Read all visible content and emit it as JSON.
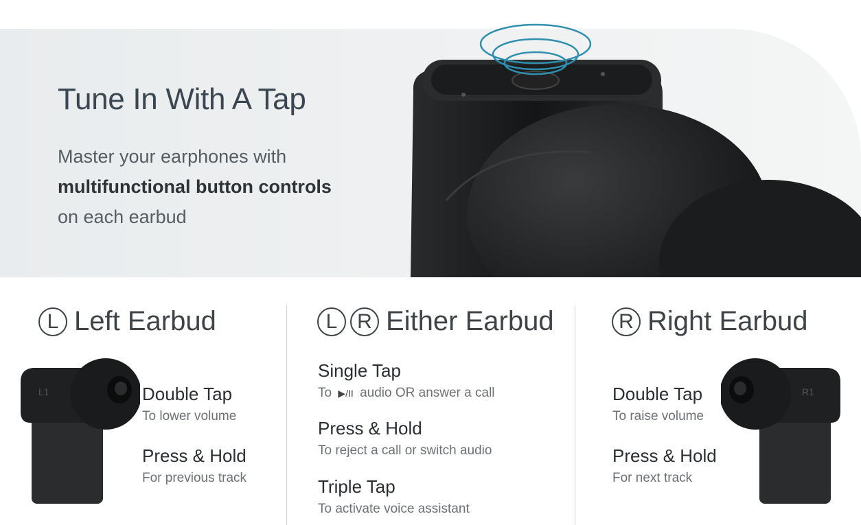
{
  "hero": {
    "title": "Tune In With A Tap",
    "subtitle_line1": "Master your earphones with",
    "subtitle_bold": "multifunctional button controls",
    "subtitle_line3": "on each earbud"
  },
  "columns": {
    "left": {
      "badge": "L",
      "title": "Left Earbud",
      "bud_label": "L1",
      "actions": [
        {
          "title": "Double Tap",
          "desc": "To lower volume"
        },
        {
          "title": "Press & Hold",
          "desc": "For previous track"
        }
      ]
    },
    "either": {
      "badge_left": "L",
      "badge_right": "R",
      "title": "Either Earbud",
      "actions": [
        {
          "title": "Single Tap",
          "desc_prefix": "To",
          "desc_symbol": "▶/II",
          "desc_suffix": "audio OR answer a call"
        },
        {
          "title": "Press & Hold",
          "desc": "To reject a call or switch audio"
        },
        {
          "title": "Triple Tap",
          "desc": "To activate voice assistant"
        }
      ]
    },
    "right": {
      "badge": "R",
      "title": "Right Earbud",
      "bud_label": "R1",
      "actions": [
        {
          "title": "Double Tap",
          "desc": "To raise volume"
        },
        {
          "title": "Press & Hold",
          "desc": "For next track"
        }
      ]
    }
  },
  "colors": {
    "hero_bg": "#eceeef",
    "heading": "#3e4347",
    "bold_text": "#2b2f33",
    "muted_text": "#6c7176",
    "ripple": "#2f8fb0",
    "product": "#1e1f21"
  }
}
